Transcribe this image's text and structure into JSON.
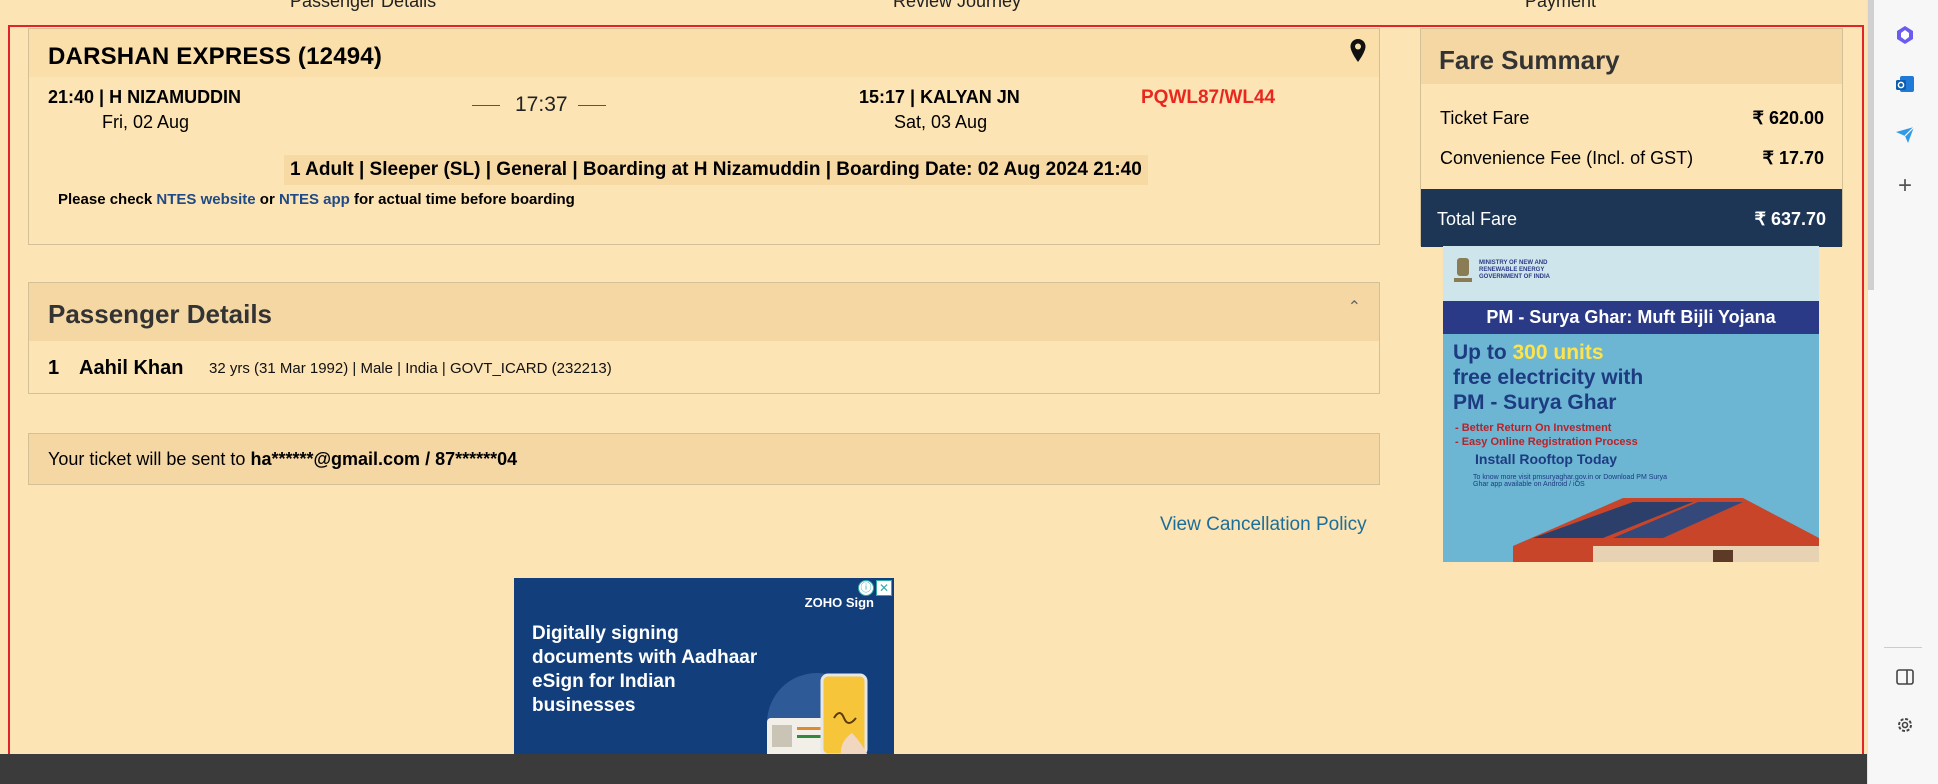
{
  "stepper": {
    "steps": [
      "Passenger Details",
      "Review Journey",
      "Payment"
    ]
  },
  "journey": {
    "train_name": "DARSHAN EXPRESS (12494)",
    "from_time_station": "21:40 | H NIZAMUDDIN",
    "from_date": "Fri, 02 Aug",
    "duration": "17:37",
    "to_time_station": "15:17 | KALYAN JN",
    "to_date": "Sat, 03 Aug",
    "status": "PQWL87/WL44",
    "booking_info": "1 Adult | Sleeper (SL) | General | Boarding at H Nizamuddin | Boarding Date: 02 Aug 2024 21:40",
    "note_prefix": "Please check",
    "note_link1": "NTES website",
    "note_or": "or",
    "note_link2": "NTES app",
    "note_suffix": "for actual time before boarding"
  },
  "passenger": {
    "title": "Passenger Details",
    "number": "1",
    "name": "Aahil Khan",
    "info": "32 yrs (31 Mar 1992) | Male | India | GOVT_ICARD (232213)"
  },
  "ticket_sent": {
    "prefix": "Your ticket will be sent to",
    "contact": "ha******@gmail.com / 87******04"
  },
  "cancel_link": "View Cancellation Policy",
  "fare": {
    "title": "Fare Summary",
    "ticket_fare_label": "Ticket Fare",
    "ticket_fare_value": "₹ 620.00",
    "conv_fee_label": "Convenience Fee (Incl. of GST)",
    "conv_fee_value": "₹ 17.70",
    "total_label": "Total Fare",
    "total_value": "₹ 637.70"
  },
  "ad_surya": {
    "ministry": "MINISTRY OF NEW AND RENEWABLE ENERGY GOVERNMENT OF INDIA",
    "band": "PM - Surya Ghar: Muft Bijli Yojana",
    "up_to": "Up to",
    "units": "300 units",
    "line2": "free electricity with",
    "line3": "PM - Surya Ghar",
    "bullet1": "- Better Return On Investment",
    "bullet2": "- Easy Online Registration Process",
    "install": "Install Rooftop Today",
    "small": "To know more visit pmsuryaghar.gov.in or Download PM Surya Ghar app available on Android / iOS"
  },
  "ad_zoho": {
    "brand": "ZOHO Sign",
    "text": "Digitally signing documents with Aadhaar eSign for Indian businesses",
    "info_icon": "ⓘ",
    "close_icon": "✕"
  },
  "colors": {
    "page_bg": "#fde4b4",
    "frame": "#e0242a",
    "status": "#e8281e",
    "total_bar": "#1d3656",
    "link": "#1c6e9a"
  }
}
